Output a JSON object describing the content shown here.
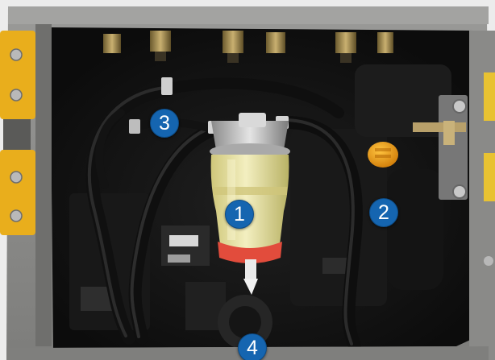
{
  "image": {
    "description_colors": {
      "frame_grey": "#8e8e8c",
      "compartment_dark": "#151515",
      "yellow_panel": "#e9ae1c",
      "callout_blue": "#1565b0",
      "filter_bowl": "#e8e29a",
      "filter_red_band": "#e24c3c",
      "cap_orange": "#f2a018"
    }
  },
  "callouts": [
    {
      "label": "1"
    },
    {
      "label": "2"
    },
    {
      "label": "3"
    },
    {
      "label": "4"
    }
  ]
}
